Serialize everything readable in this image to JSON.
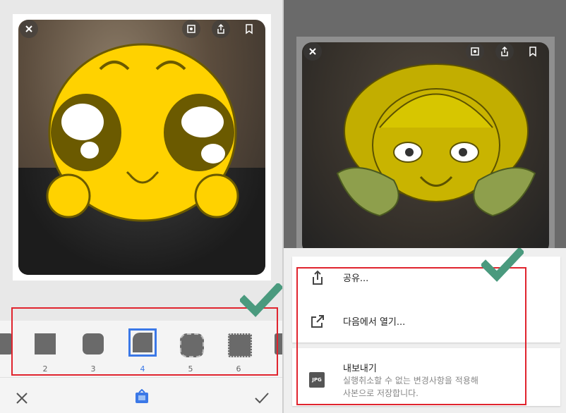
{
  "left": {
    "thumbnails": [
      {
        "num": ""
      },
      {
        "num": "2"
      },
      {
        "num": "3"
      },
      {
        "num": "4",
        "selected": true
      },
      {
        "num": "5"
      },
      {
        "num": "6"
      },
      {
        "num": ""
      }
    ],
    "toolbar": {
      "cancel_icon": "close-icon",
      "frame_icon": "frame-icon",
      "confirm_icon": "check-icon"
    }
  },
  "right": {
    "menu": {
      "share": "공유...",
      "open_in": "다음에서 열기...",
      "export_title": "내보내기",
      "export_desc_1": "실행취소할 수 없는 변경사항을 적용해",
      "export_desc_2": "사본으로 저장합니다.",
      "jpg_badge": "JPG"
    }
  },
  "colors": {
    "accent": "#3b78e7",
    "highlight": "#e0242e",
    "check": "#4a9a7e",
    "emoji": "#ffd200"
  }
}
